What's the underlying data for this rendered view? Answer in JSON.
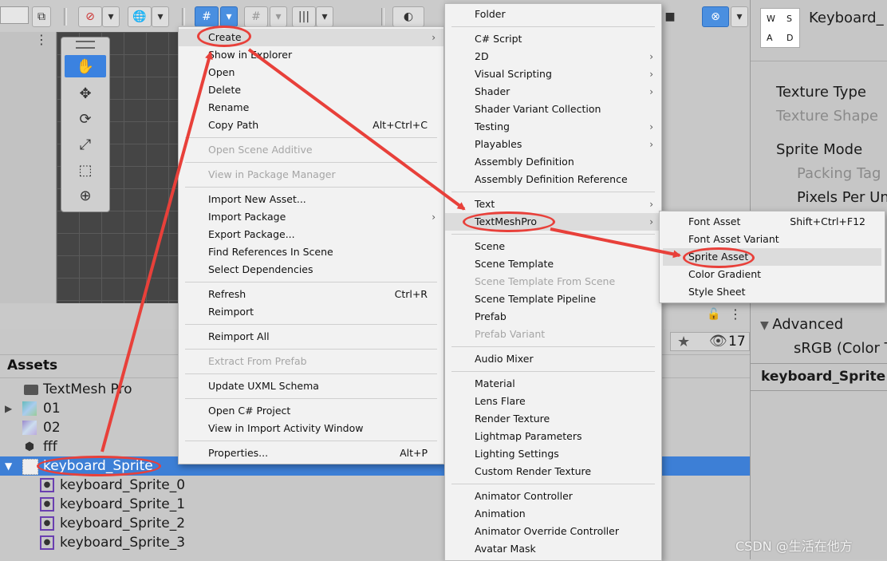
{
  "toolbar": {
    "icons": [
      "pivot-icon",
      "global-icon",
      "grid-snap-icon",
      "increment-snap-icon",
      "measure-icon",
      "shading-icon",
      "camera-icon",
      "gizmo-icon"
    ]
  },
  "scene_tools": [
    "hand-tool",
    "move-tool",
    "rotate-tool",
    "scale-tool",
    "rect-tool",
    "transform-tool"
  ],
  "project": {
    "hidden_count": "17",
    "assets_header": "Assets",
    "tree": [
      {
        "label": "TextMesh Pro",
        "icon": "folder-icon"
      },
      {
        "label": "01",
        "icon": "image-icon"
      },
      {
        "label": "02",
        "icon": "image-icon"
      },
      {
        "label": "fff",
        "icon": "prefab-icon"
      },
      {
        "label": "keyboard_Sprite",
        "icon": "sprite-sheet-icon"
      },
      {
        "label": "keyboard_Sprite_0",
        "icon": "sprite-icon"
      },
      {
        "label": "keyboard_Sprite_1",
        "icon": "sprite-icon"
      },
      {
        "label": "keyboard_Sprite_2",
        "icon": "sprite-icon"
      },
      {
        "label": "keyboard_Sprite_3",
        "icon": "sprite-icon"
      }
    ]
  },
  "inspector": {
    "title": "Keyboard_",
    "thumb": [
      "W",
      "S",
      "A",
      "D"
    ],
    "texture_type": "Texture Type",
    "texture_shape": "Texture Shape",
    "sprite_mode": "Sprite Mode",
    "packing_tag": "Packing Tag",
    "pixels_per_unit": "Pixels Per Un",
    "advanced": "Advanced",
    "srgb": "sRGB (Color T",
    "footer": "keyboard_Sprite"
  },
  "menu1": {
    "items": [
      {
        "label": "Create",
        "arrow": "›",
        "highlight": true
      },
      {
        "label": "Show in Explorer"
      },
      {
        "label": "Open"
      },
      {
        "label": "Delete"
      },
      {
        "label": "Rename"
      },
      {
        "label": "Copy Path",
        "shortcut": "Alt+Ctrl+C"
      },
      {
        "label": "Open Scene Additive",
        "disabled": true
      },
      {
        "label": "View in Package Manager",
        "disabled": true
      },
      {
        "label": "Import New Asset..."
      },
      {
        "label": "Import Package",
        "arrow": "›"
      },
      {
        "label": "Export Package..."
      },
      {
        "label": "Find References In Scene"
      },
      {
        "label": "Select Dependencies"
      },
      {
        "label": "Refresh",
        "shortcut": "Ctrl+R"
      },
      {
        "label": "Reimport"
      },
      {
        "label": "Reimport All"
      },
      {
        "label": "Extract From Prefab",
        "disabled": true
      },
      {
        "label": "Update UXML Schema"
      },
      {
        "label": "Open C# Project"
      },
      {
        "label": "View in Import Activity Window"
      },
      {
        "label": "Properties...",
        "shortcut": "Alt+P"
      }
    ]
  },
  "menu2": {
    "items": [
      {
        "label": "Folder"
      },
      {
        "label": "C# Script"
      },
      {
        "label": "2D",
        "arrow": "›"
      },
      {
        "label": "Visual Scripting",
        "arrow": "›"
      },
      {
        "label": "Shader",
        "arrow": "›"
      },
      {
        "label": "Shader Variant Collection"
      },
      {
        "label": "Testing",
        "arrow": "›"
      },
      {
        "label": "Playables",
        "arrow": "›"
      },
      {
        "label": "Assembly Definition"
      },
      {
        "label": "Assembly Definition Reference"
      },
      {
        "label": "Text",
        "arrow": "›"
      },
      {
        "label": "TextMeshPro",
        "arrow": "›",
        "highlight": true
      },
      {
        "label": "Scene"
      },
      {
        "label": "Scene Template"
      },
      {
        "label": "Scene Template From Scene",
        "disabled": true
      },
      {
        "label": "Scene Template Pipeline"
      },
      {
        "label": "Prefab"
      },
      {
        "label": "Prefab Variant",
        "disabled": true
      },
      {
        "label": "Audio Mixer"
      },
      {
        "label": "Material"
      },
      {
        "label": "Lens Flare"
      },
      {
        "label": "Render Texture"
      },
      {
        "label": "Lightmap Parameters"
      },
      {
        "label": "Lighting Settings"
      },
      {
        "label": "Custom Render Texture"
      },
      {
        "label": "Animator Controller"
      },
      {
        "label": "Animation"
      },
      {
        "label": "Animator Override Controller"
      },
      {
        "label": "Avatar Mask"
      }
    ]
  },
  "menu3": {
    "items": [
      {
        "label": "Font Asset",
        "shortcut": "Shift+Ctrl+F12"
      },
      {
        "label": "Font Asset Variant"
      },
      {
        "label": "Sprite Asset",
        "highlight": true
      },
      {
        "label": "Color Gradient"
      },
      {
        "label": "Style Sheet"
      }
    ]
  },
  "annotation_color": "#e8403a",
  "watermark": "CSDN @生活在他方"
}
